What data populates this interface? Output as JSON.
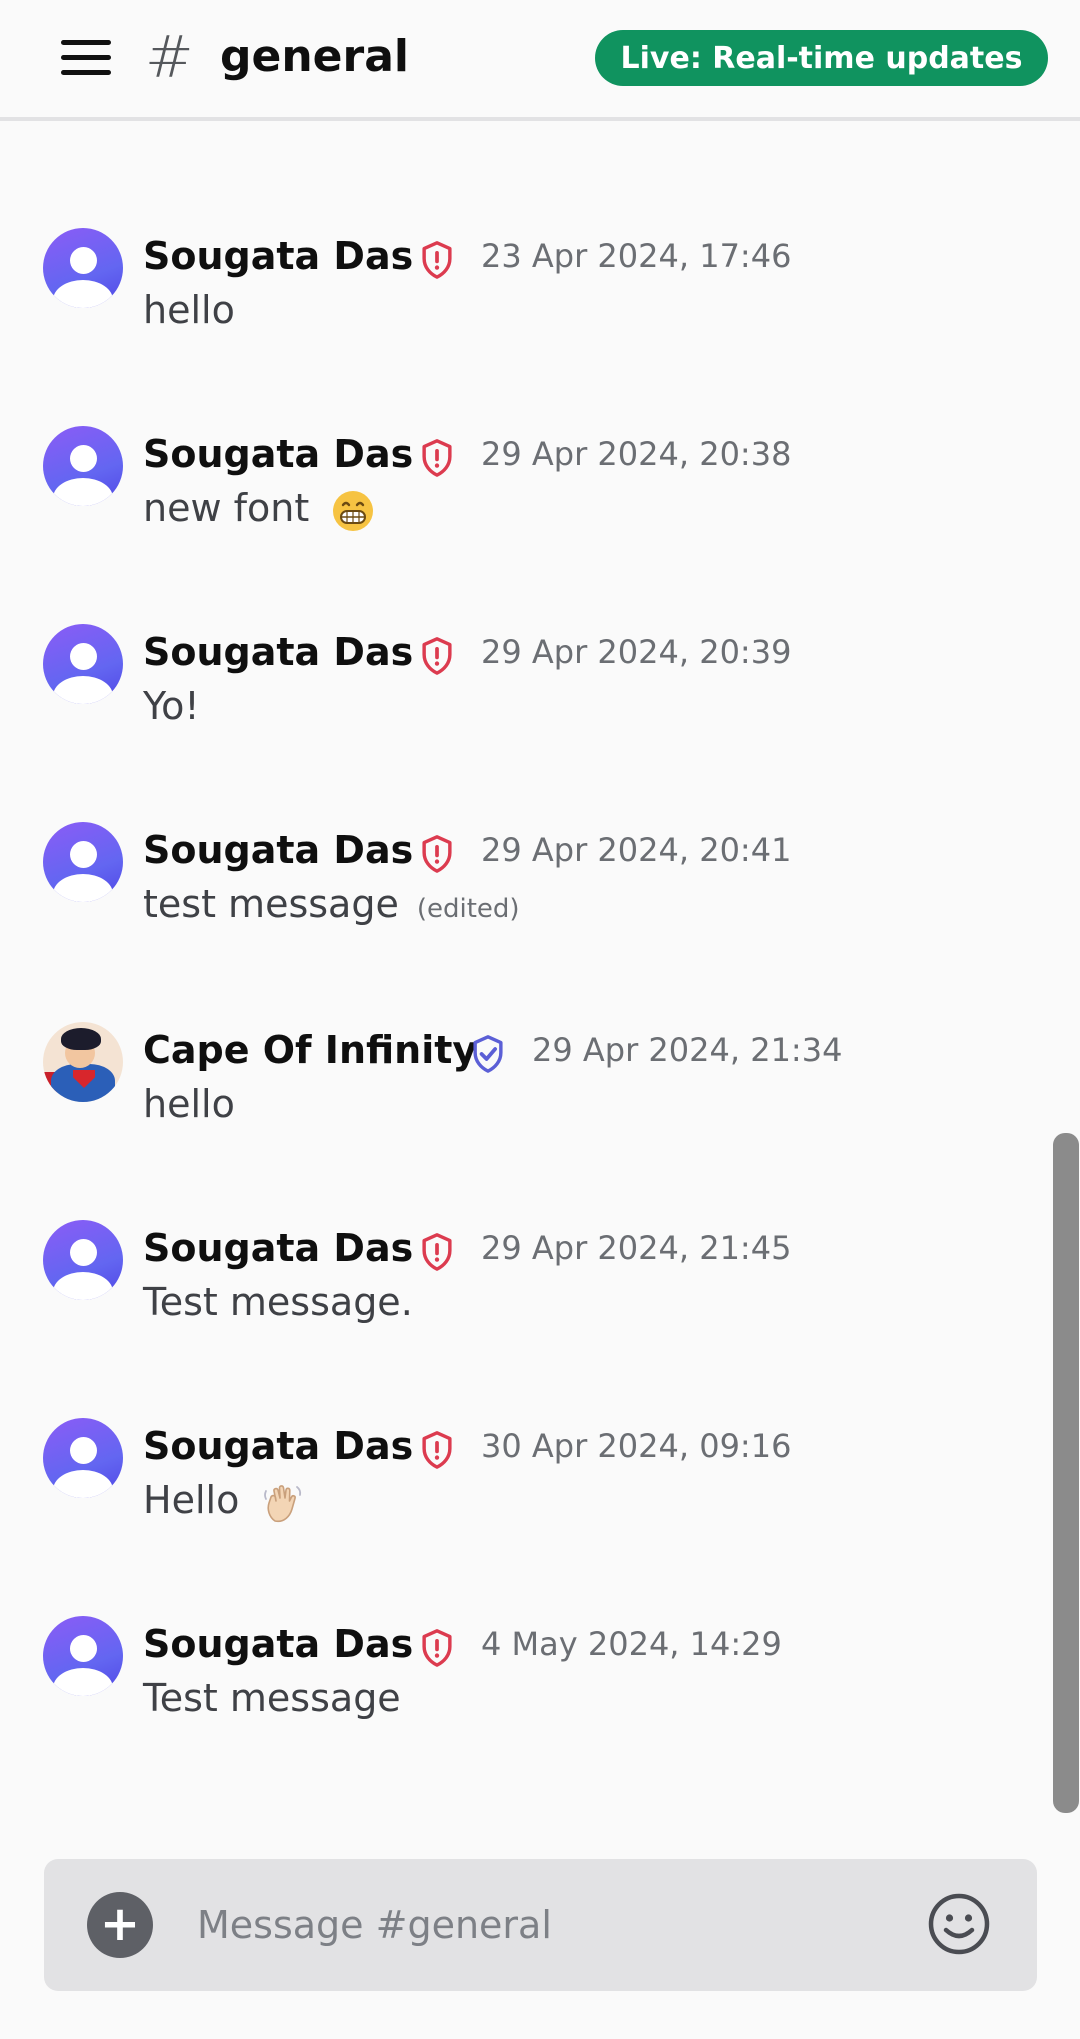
{
  "header": {
    "channel_hash": "#",
    "channel_name": "general",
    "live_badge": "Live: Real-time updates"
  },
  "messages": [
    {
      "author": "Sougata Das",
      "timestamp": "23 Apr 2024, 17:46",
      "text": "hello",
      "role_icon": "shield-alert-icon",
      "avatar": "default"
    },
    {
      "author": "Sougata Das",
      "timestamp": "29 Apr 2024, 20:38",
      "text": "new font",
      "emoji": "grinning-face-emoji",
      "role_icon": "shield-alert-icon",
      "avatar": "default"
    },
    {
      "author": "Sougata Das",
      "timestamp": "29 Apr 2024, 20:39",
      "text": "Yo!",
      "role_icon": "shield-alert-icon",
      "avatar": "default"
    },
    {
      "author": "Sougata Das",
      "timestamp": "29 Apr 2024, 20:41",
      "text": "test message",
      "edited": "(edited)",
      "role_icon": "shield-alert-icon",
      "avatar": "default"
    },
    {
      "author": "Cape Of Infinity",
      "timestamp": "29 Apr 2024, 21:34",
      "text": "hello",
      "role_icon": "shield-check-icon",
      "avatar": "photo"
    },
    {
      "author": "Sougata Das",
      "timestamp": "29 Apr 2024, 21:45",
      "text": "Test message.",
      "role_icon": "shield-alert-icon",
      "avatar": "default"
    },
    {
      "author": "Sougata Das",
      "timestamp": "30 Apr 2024, 09:16",
      "text": "Hello",
      "emoji": "waving-hand-emoji",
      "role_icon": "shield-alert-icon",
      "avatar": "default"
    },
    {
      "author": "Sougata Das",
      "timestamp": "4 May 2024, 14:29",
      "text": "Test message",
      "role_icon": "shield-alert-icon",
      "avatar": "default"
    }
  ],
  "composer": {
    "placeholder": "Message #general",
    "add_icon": "plus-icon",
    "emoji_icon": "smiley-icon"
  },
  "colors": {
    "live_badge_bg": "#10935f",
    "admin_shield": "#dc3b4f",
    "verified_shield": "#5b5fd6",
    "avatar_gradient": "#6366f1"
  }
}
